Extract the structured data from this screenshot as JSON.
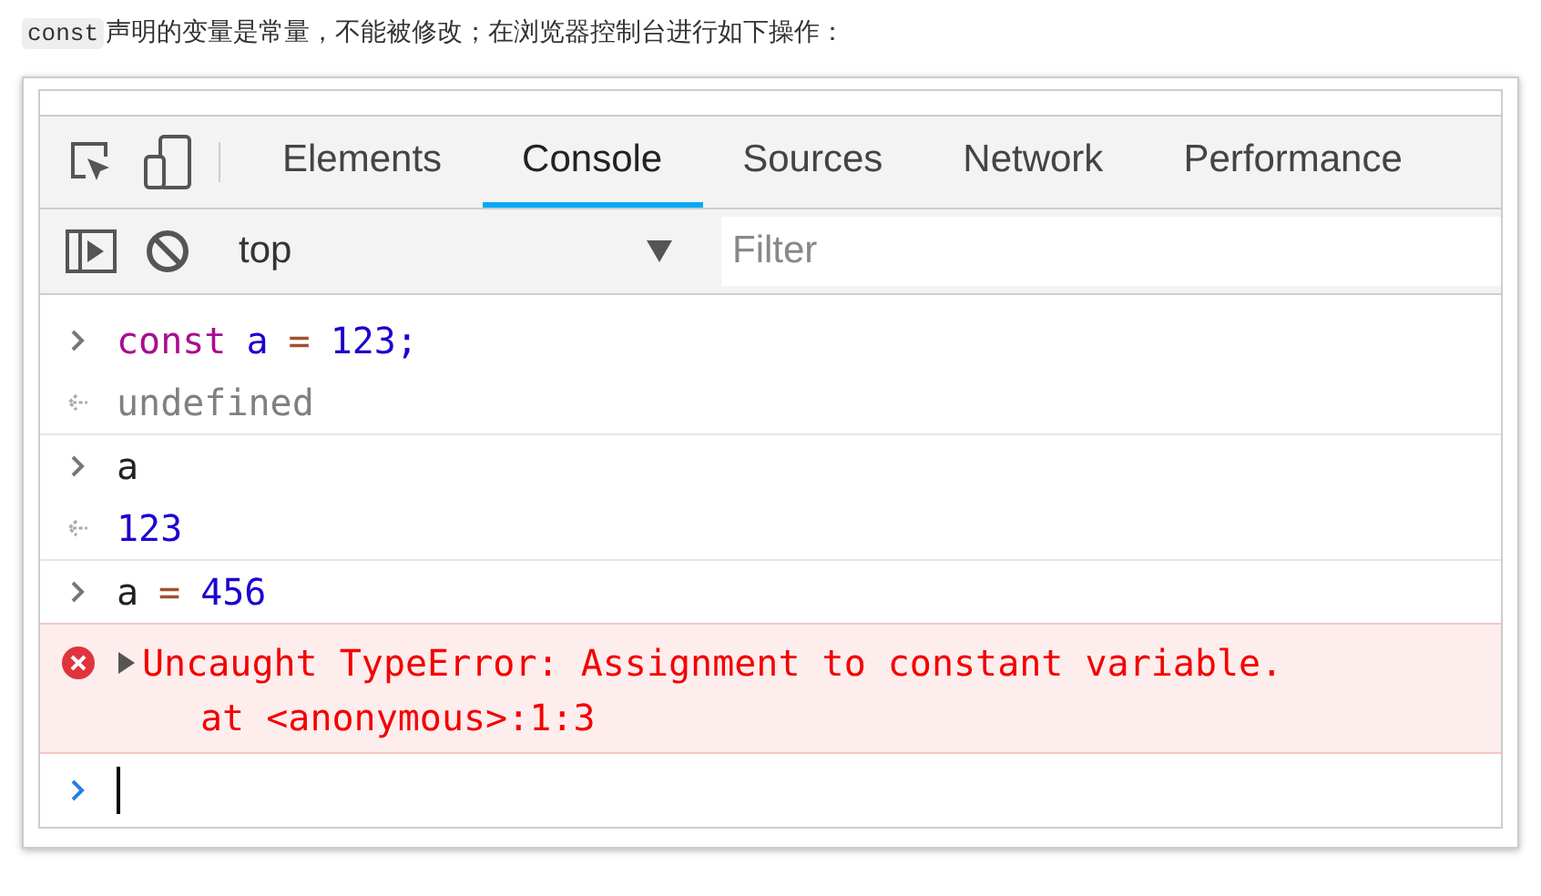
{
  "intro": {
    "code": "const",
    "text": "声明的变量是常量，不能被修改；在浏览器控制台进行如下操作："
  },
  "tabs": [
    {
      "label": "Elements",
      "selected": false
    },
    {
      "label": "Console",
      "selected": true
    },
    {
      "label": "Sources",
      "selected": false
    },
    {
      "label": "Network",
      "selected": false
    },
    {
      "label": "Performance",
      "selected": false
    }
  ],
  "toolbar": {
    "context": "top",
    "filter": {
      "placeholder": "Filter"
    }
  },
  "console": [
    {
      "kind": "input",
      "tokens": [
        {
          "kind": "keyword",
          "text": "const"
        },
        {
          "kind": "variable",
          "text": "a"
        },
        {
          "kind": "operator",
          "text": "="
        },
        {
          "kind": "number",
          "text": "123;"
        }
      ]
    },
    {
      "kind": "output",
      "tokens": [
        {
          "kind": "undefined",
          "text": "undefined"
        }
      ],
      "group_end": true
    },
    {
      "kind": "input",
      "tokens": [
        {
          "kind": "plain",
          "text": "a"
        }
      ]
    },
    {
      "kind": "output",
      "tokens": [
        {
          "kind": "number",
          "text": "123"
        }
      ],
      "group_end": true
    },
    {
      "kind": "input",
      "tokens": [
        {
          "kind": "plain",
          "text": "a"
        },
        {
          "kind": "operator",
          "text": "="
        },
        {
          "kind": "number",
          "text": "456"
        }
      ]
    },
    {
      "kind": "error",
      "expanded": false,
      "message": "Uncaught TypeError: Assignment to constant variable.",
      "trace": "at <anonymous>:1:3"
    },
    {
      "kind": "prompt"
    }
  ]
}
